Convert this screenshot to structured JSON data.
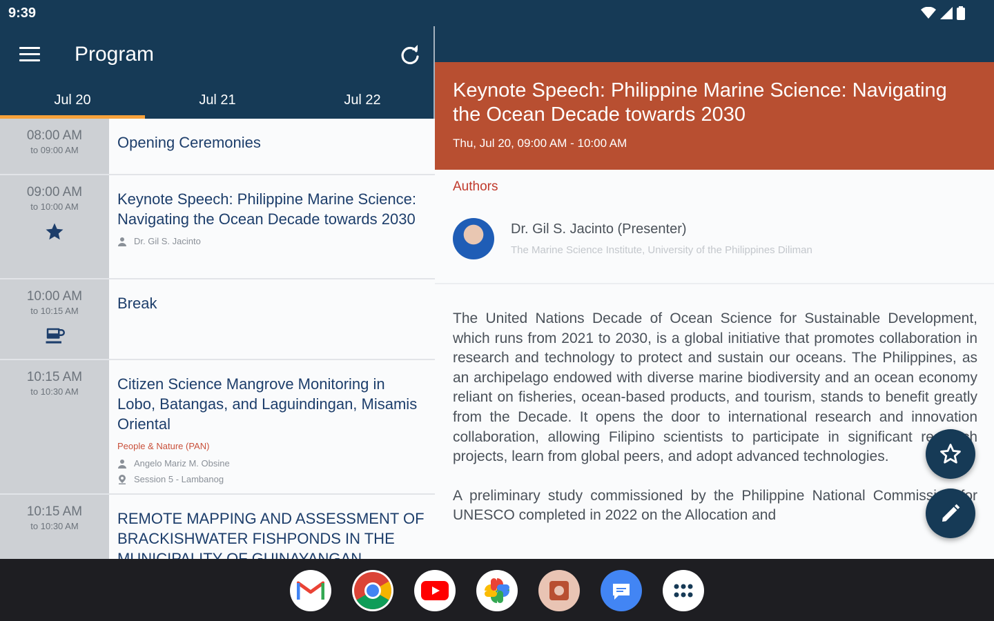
{
  "status_bar": {
    "time": "9:39"
  },
  "app": {
    "title": "Program"
  },
  "tabs": [
    {
      "label": "Jul 20",
      "active": true
    },
    {
      "label": "Jul 21",
      "active": false
    },
    {
      "label": "Jul 22",
      "active": false
    }
  ],
  "sessions": [
    {
      "start": "08:00 AM",
      "end": "to 09:00 AM",
      "title": "Opening Ceremonies"
    },
    {
      "start": "09:00 AM",
      "end": "to 10:00 AM",
      "title": "Keynote Speech: Philippine Marine Science: Navigating the Ocean Decade towards 2030",
      "author": "Dr. Gil S. Jacinto",
      "badge": "star-icon"
    },
    {
      "start": "10:00 AM",
      "end": "to 10:15 AM",
      "title": "Break",
      "badge": "coffee-icon"
    },
    {
      "start": "10:15 AM",
      "end": "to 10:30 AM",
      "title": "Citizen Science Mangrove Monitoring in Lobo, Batangas, and Laguindingan, Misamis Oriental",
      "track": "People & Nature (PAN)",
      "author": "Angelo Mariz M. Obsine",
      "location": "Session 5 - Lambanog"
    },
    {
      "start": "10:15 AM",
      "end": "to 10:30 AM",
      "title": "REMOTE MAPPING AND ASSESSMENT OF BRACKISHWATER FISHPONDS IN THE MUNICIPALITY OF GUINAYANGAN"
    }
  ],
  "detail": {
    "title": "Keynote Speech: Philippine Marine Science: Navigating the Ocean Decade towards 2030",
    "time": "Thu, Jul 20, 09:00 AM - 10:00 AM",
    "authors_label": "Authors",
    "author_name": "Dr. Gil S. Jacinto  (Presenter)",
    "author_affiliation": "The Marine Science Institute, University of the Philippines Diliman",
    "abstract_p1": "The United Nations Decade of Ocean Science for Sustainable Development, which runs from 2021 to 2030, is a global initiative that promotes collaboration in research and technology to protect and sustain our oceans. The Philippines, as an archipelago endowed with diverse marine biodiversity and an ocean economy reliant on fisheries, ocean-based products, and tourism, stands to benefit greatly from the Decade. It opens the door to international research and innovation collaboration, allowing Filipino scientists to participate in significant research projects, learn from global peers, and adopt advanced technologies.",
    "abstract_p2": "A preliminary study commissioned by the Philippine National Commission for UNESCO completed in 2022 on the Allocation and"
  },
  "colors": {
    "primary": "#163a56",
    "accent": "#b84f31",
    "tab_indicator": "#f7a23b"
  },
  "dock": [
    "gmail-icon",
    "chrome-icon",
    "youtube-icon",
    "photos-icon",
    "camera-app-icon",
    "messages-icon",
    "app-drawer-icon"
  ]
}
